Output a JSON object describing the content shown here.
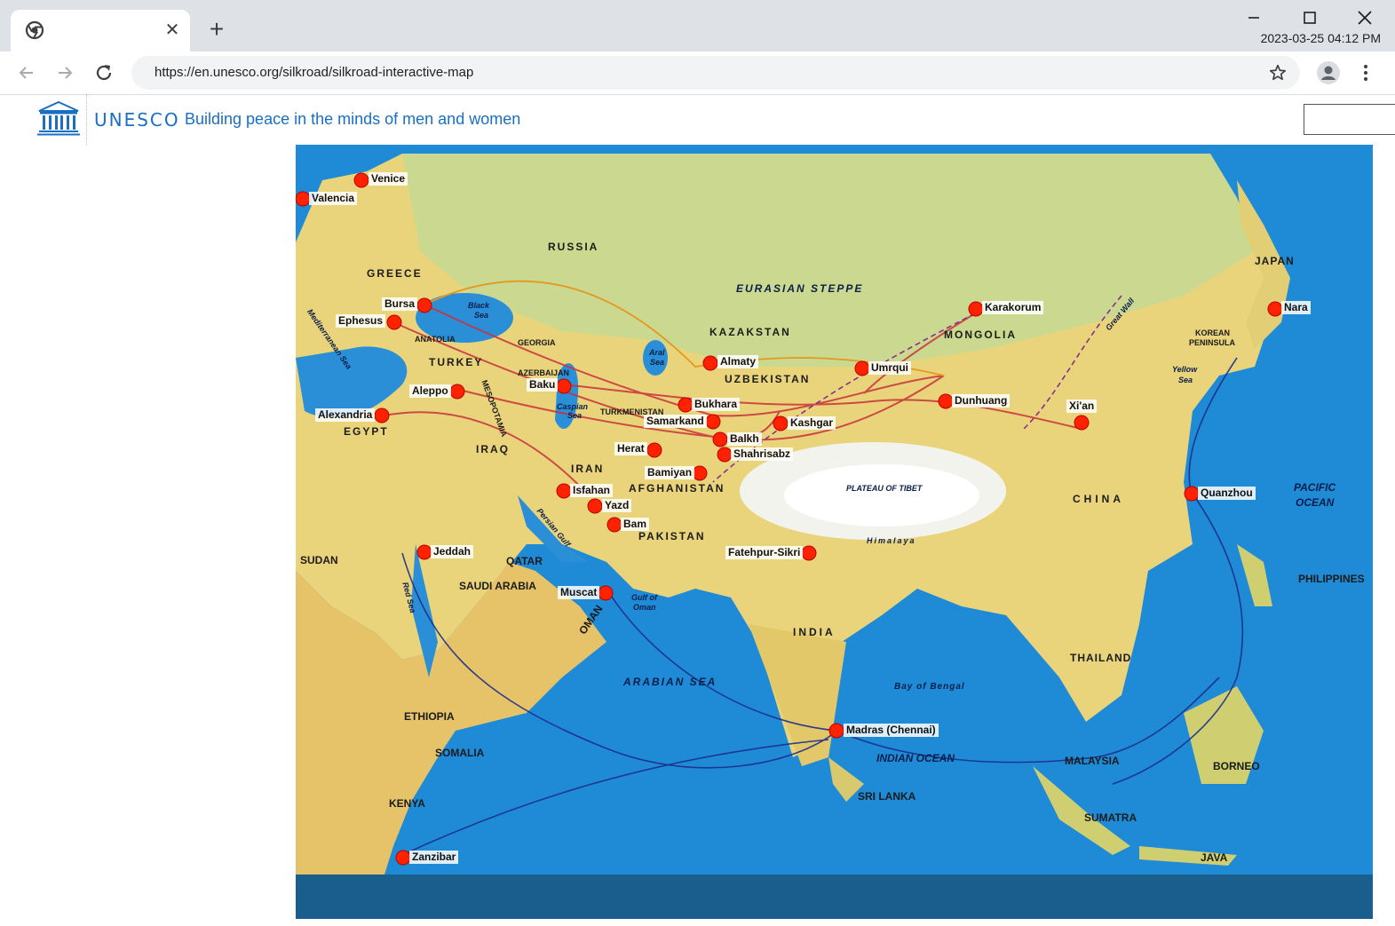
{
  "browser": {
    "tab_close": "✕",
    "new_tab": "+",
    "datetime": "2023-03-25 04:12 PM",
    "url": "https://en.unesco.org/silkroad/silkroad-interactive-map"
  },
  "header": {
    "brand": "UNESCO",
    "tagline": "Building peace in the minds of men and women"
  },
  "map": {
    "cities": {
      "venice": "Venice",
      "valencia": "Valencia",
      "bursa": "Bursa",
      "ephesus": "Ephesus",
      "aleppo": "Aleppo",
      "alexandria": "Alexandria",
      "baku": "Baku",
      "almaty": "Almaty",
      "bukhara": "Bukhara",
      "samarkand": "Samarkand",
      "balkh": "Balkh",
      "shahrisabz": "Shahrisabz",
      "kashgar": "Kashgar",
      "herat": "Herat",
      "bamiyan": "Bamiyan",
      "isfahan": "Isfahan",
      "yazd": "Yazd",
      "bam": "Bam",
      "jeddah": "Jeddah",
      "muscat": "Muscat",
      "karakorum": "Karakorum",
      "umrumqi": "Umrqui",
      "dunhuang": "Dunhuang",
      "xian": "Xi'an",
      "nara": "Nara",
      "quanzhou": "Quanzhou",
      "fatehpur": "Fatehpur-Sikri",
      "madras": "Madras (Chennai)",
      "zanzibar": "Zanzibar"
    },
    "regions": {
      "russia": "RUSSIA",
      "greece": "GREECE",
      "turkey": "TURKEY",
      "anatolia": "ANATOLIA",
      "georgia": "GEORGIA",
      "azerbaijan": "AZERBAIJAN",
      "turkmenistan": "TURKMENISTAN",
      "egypt": "EGYPT",
      "iraq": "IRAQ",
      "iran": "IRAN",
      "afghanistan": "AFGHANISTAN",
      "pakistan": "PAKISTAN",
      "kazakstan": "KAZAKSTAN",
      "uzbekistan": "UZBEKISTAN",
      "mongolia": "MONGOLIA",
      "china": "CHINA",
      "japan": "JAPAN",
      "korea_1": "KOREAN",
      "korea_2": "PENINSULA",
      "sudan": "SUDAN",
      "qatar": "QATAR",
      "saudi": "SAUDI ARABIA",
      "oman": "OMAN",
      "india": "INDIA",
      "thailand": "THAILAND",
      "philippines": "PHILIPPINES",
      "ethiopia": "ETHIOPIA",
      "somalia": "SOMALIA",
      "kenya": "KENYA",
      "malaysia": "MALAYSIA",
      "borneo": "BORNEO",
      "sumatra": "SUMATRA",
      "java": "JAVA",
      "srilanka": "SRI LANKA",
      "mesopotamia": "MESOPOTAMIA"
    },
    "seas": {
      "steppe": "EURASIAN STEPPE",
      "tibet": "PLATEAU OF TIBET",
      "himalaya": "Himalaya",
      "great_wall": "Great Wall",
      "mediterranean": "Mediterranean Sea",
      "black_1": "Black",
      "black_2": "Sea",
      "caspian_1": "Caspian",
      "caspian_2": "Sea",
      "aral_1": "Aral",
      "aral_2": "Sea",
      "yellow_1": "Yellow",
      "yellow_2": "Sea",
      "red": "Red Sea",
      "persian": "Persian Gulf",
      "oman_gulf_1": "Gulf of",
      "oman_gulf_2": "Oman",
      "arabian": "ARABIAN SEA",
      "bengal": "Bay of Bengal",
      "indian": "INDIAN OCEAN",
      "pacific_1": "PACIFIC",
      "pacific_2": "OCEAN"
    }
  },
  "colors": {
    "ocean": "#1f8ad6",
    "land": "#e8d27a",
    "city_marker": "#ff2200",
    "brand_blue": "#1a6fc4"
  }
}
